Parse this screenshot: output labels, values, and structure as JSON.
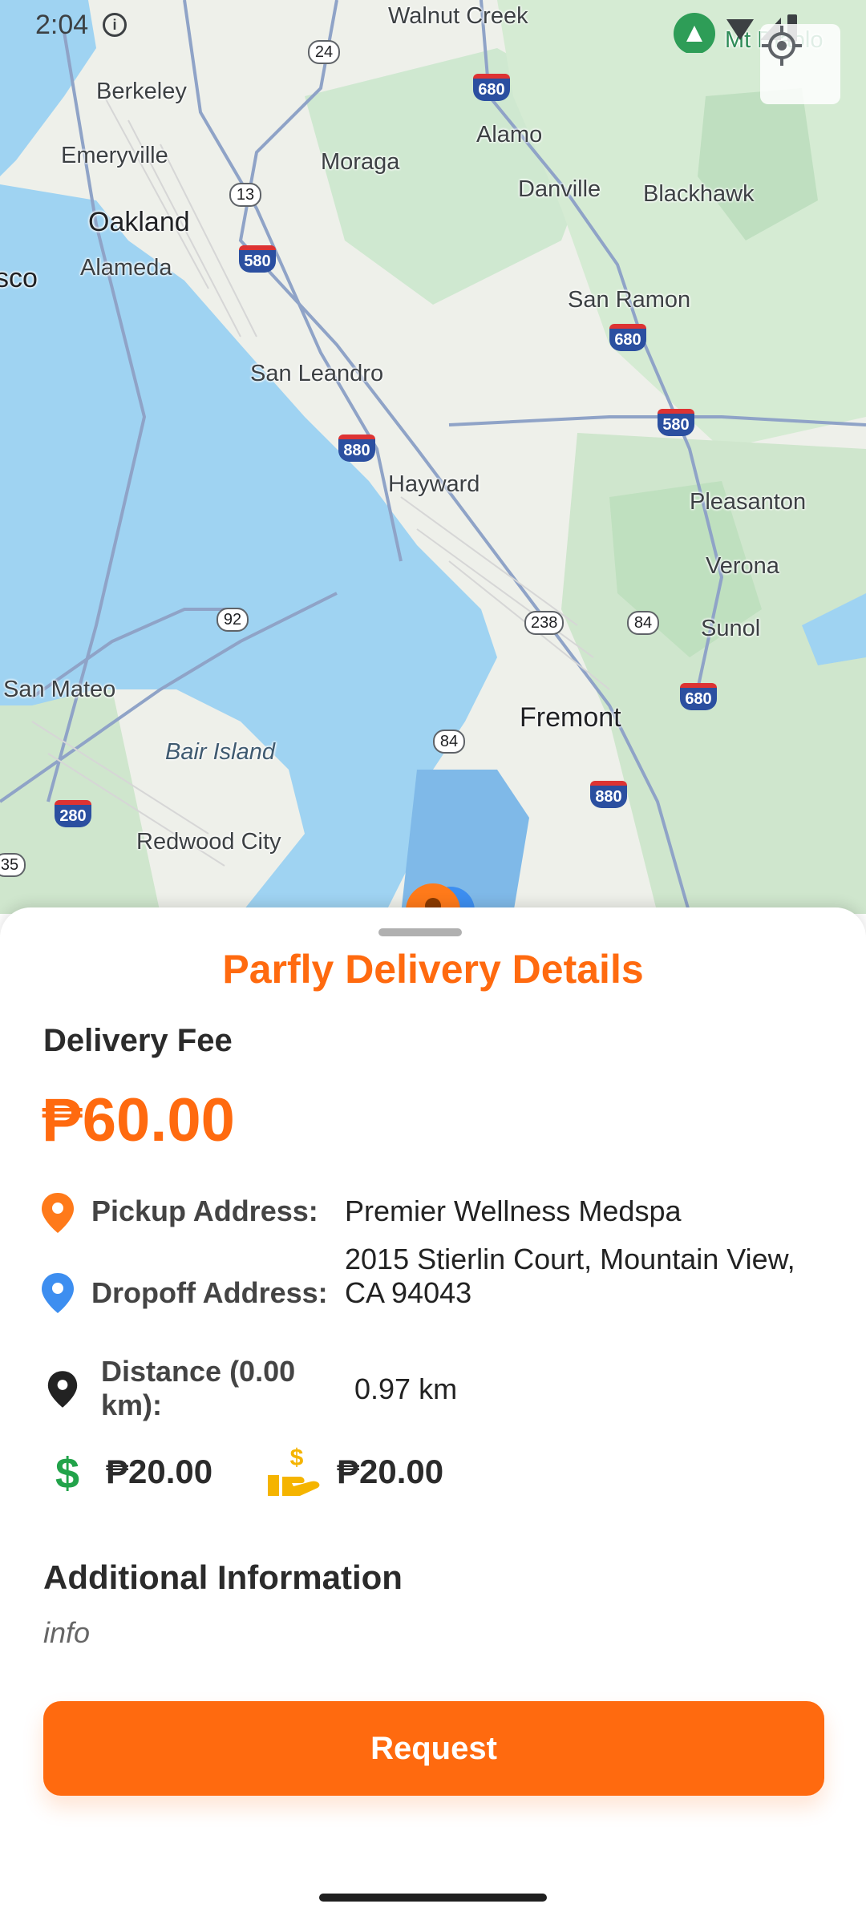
{
  "status_bar": {
    "time": "2:04",
    "info_glyph": "i",
    "icons": [
      "location-pin-icon",
      "wifi-icon",
      "signal-icon",
      "battery-icon"
    ]
  },
  "map": {
    "labels": {
      "walnut_creek": "Walnut Creek",
      "berkeley": "Berkeley",
      "emeryville": "Emeryville",
      "moraga": "Moraga",
      "alamo": "Alamo",
      "danville": "Danville",
      "blackhawk": "Blackhawk",
      "oakland": "Oakland",
      "alameda": "Alameda",
      "sco": "sco",
      "san_ramon": "San Ramon",
      "san_leandro": "San Leandro",
      "hayward": "Hayward",
      "pleasanton": "Pleasanton",
      "verona": "Verona",
      "sunol": "Sunol",
      "san_mateo": "San Mateo",
      "fremont": "Fremont",
      "bair_island": "Bair Island",
      "redwood_city": "Redwood City",
      "mt_diablo": "Mt Diablo"
    },
    "shields": {
      "i680_a": "680",
      "i580_a": "580",
      "i680_b": "680",
      "i580_b": "580",
      "i880_a": "880",
      "i680_c": "680",
      "i880_b": "880",
      "i280": "280"
    },
    "routes": {
      "r24": "24",
      "r13": "13",
      "r92": "92",
      "r238": "238",
      "r84_a": "84",
      "r84_b": "84",
      "r35": "35"
    }
  },
  "sheet": {
    "title": "Parfly Delivery Details",
    "fee_label": "Delivery Fee",
    "fee_amount": "₱60.00",
    "pickup": {
      "label": "Pickup Address:",
      "value": "Premier Wellness Medspa"
    },
    "dropoff": {
      "label": "Dropoff Address:",
      "value_line1": "2015 Stierlin Court, Mountain View,",
      "value_line2": "CA 94043"
    },
    "distance": {
      "label_line1": "Distance (0.00",
      "label_line2": "km):",
      "value": "0.97 km"
    },
    "amount_1": "₱20.00",
    "amount_2": "₱20.00",
    "additional_title": "Additional Information",
    "additional_text": "info",
    "request_label": "Request"
  },
  "colors": {
    "accent": "#ff6a0f",
    "pickup_pin": "#ff7a1a",
    "dropoff_pin": "#3d8ef0",
    "distance_pin": "#222222",
    "dollar_green": "#22a34a",
    "hand_yellow": "#f5b400"
  }
}
